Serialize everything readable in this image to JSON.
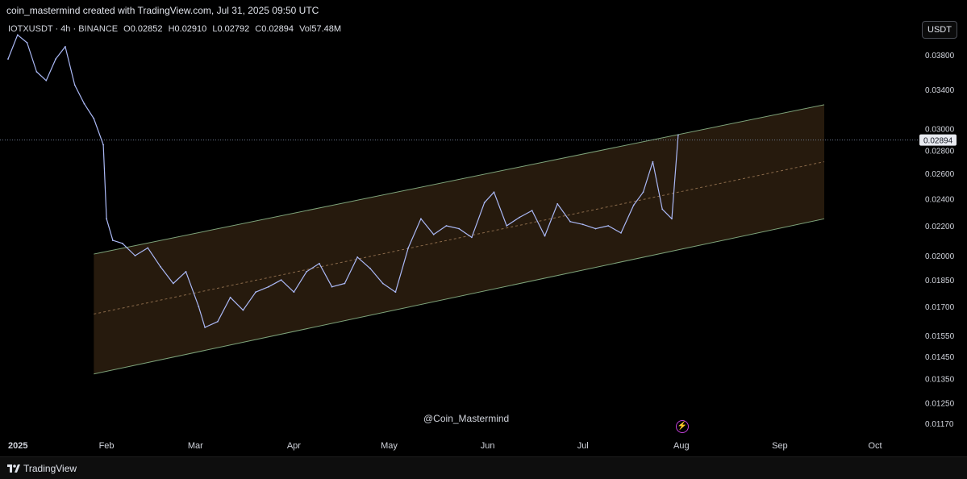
{
  "header": {
    "credit": "coin_mastermind created with TradingView.com, Jul 31, 2025 09:50 UTC",
    "symbol": "IOTXUSDT · 4h · BINANCE",
    "open_label": "O",
    "open_value": "0.02852",
    "high_label": "H",
    "high_value": "0.02910",
    "low_label": "L",
    "low_value": "0.02792",
    "close_label": "C",
    "close_value": "0.02894",
    "vol_label": "Vol",
    "vol_value": "57.48M",
    "currency_button": "USDT"
  },
  "watermark": "@Coin_Mastermind",
  "footer": {
    "brand": "TradingView",
    "brand_icon": "tradingview-logo-icon"
  },
  "colors": {
    "background": "#000000",
    "price_line": "#aab8f5",
    "channel_fill": "#2a1d0e",
    "channel_border": "#7ea37a",
    "midline": "#8a6a4a",
    "last_price_label_bg": "#e8eaf0",
    "alert_icon": "#c03fd8"
  },
  "chart_data": {
    "type": "line",
    "x_tick_labels": [
      "2025",
      "Feb",
      "Mar",
      "Apr",
      "May",
      "Jun",
      "Jul",
      "Aug",
      "Sep",
      "Oct"
    ],
    "y_tick_labels": [
      "0.03800",
      "0.03400",
      "0.03000",
      "0.02800",
      "0.02600",
      "0.02400",
      "0.02200",
      "0.02000",
      "0.01850",
      "0.01700",
      "0.01550",
      "0.01450",
      "0.01350",
      "0.01250",
      "0.01170"
    ],
    "y_scale": "log",
    "last_price": "0.02894",
    "series": [
      {
        "x": [
          "2025-01-01",
          "2025-01-04",
          "2025-01-07",
          "2025-01-10",
          "2025-01-13",
          "2025-01-16",
          "2025-01-19",
          "2025-01-22",
          "2025-01-25",
          "2025-01-28",
          "2025-01-31",
          "2025-02-01",
          "2025-02-03",
          "2025-02-06",
          "2025-02-10",
          "2025-02-14",
          "2025-02-18",
          "2025-02-22",
          "2025-02-26",
          "2025-03-02",
          "2025-03-04",
          "2025-03-08",
          "2025-03-12",
          "2025-03-16",
          "2025-03-20",
          "2025-03-24",
          "2025-03-28",
          "2025-04-01",
          "2025-04-05",
          "2025-04-09",
          "2025-04-13",
          "2025-04-17",
          "2025-04-21",
          "2025-04-25",
          "2025-04-29",
          "2025-05-03",
          "2025-05-07",
          "2025-05-11",
          "2025-05-15",
          "2025-05-19",
          "2025-05-23",
          "2025-05-27",
          "2025-05-31",
          "2025-06-03",
          "2025-06-07",
          "2025-06-11",
          "2025-06-15",
          "2025-06-19",
          "2025-06-23",
          "2025-06-27",
          "2025-07-01",
          "2025-07-05",
          "2025-07-09",
          "2025-07-13",
          "2025-07-17",
          "2025-07-20",
          "2025-07-23",
          "2025-07-26",
          "2025-07-29",
          "2025-07-31"
        ],
        "y": [
          0.0375,
          0.0405,
          0.0395,
          0.036,
          0.035,
          0.0375,
          0.039,
          0.0345,
          0.0325,
          0.031,
          0.0285,
          0.0225,
          0.021,
          0.0208,
          0.02,
          0.0205,
          0.0193,
          0.0183,
          0.019,
          0.017,
          0.0159,
          0.0162,
          0.0175,
          0.0168,
          0.0178,
          0.0181,
          0.0185,
          0.0178,
          0.019,
          0.0195,
          0.0181,
          0.0183,
          0.0199,
          0.0192,
          0.0183,
          0.0178,
          0.0205,
          0.0225,
          0.0214,
          0.022,
          0.0218,
          0.0212,
          0.0237,
          0.0245,
          0.022,
          0.0226,
          0.0231,
          0.0213,
          0.0236,
          0.0223,
          0.0221,
          0.0218,
          0.022,
          0.0215,
          0.0235,
          0.0245,
          0.027,
          0.0232,
          0.0225,
          0.0294
        ]
      }
    ],
    "channel": {
      "upper": [
        {
          "x": "2025-01-28",
          "y": 0.0201
        },
        {
          "x": "2025-09-15",
          "y": 0.0324
        }
      ],
      "lower": [
        {
          "x": "2025-01-28",
          "y": 0.0137
        },
        {
          "x": "2025-09-15",
          "y": 0.0225
        }
      ]
    }
  }
}
